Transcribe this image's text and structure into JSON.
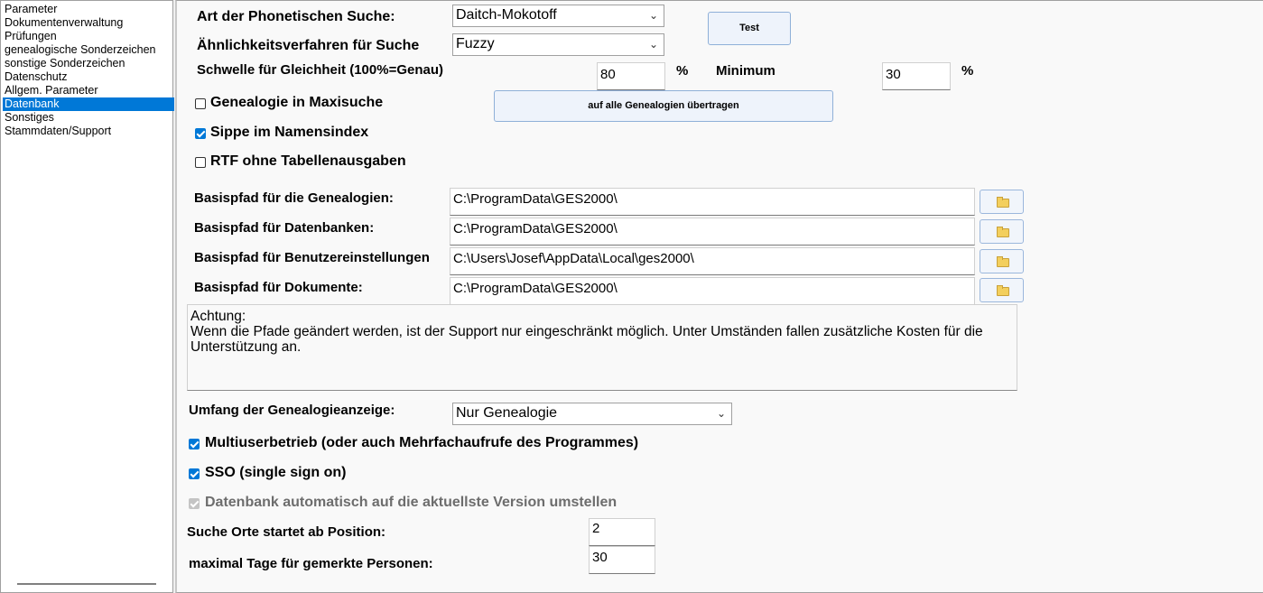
{
  "sidebar": {
    "items": [
      {
        "label": "Parameter",
        "active": false
      },
      {
        "label": "Dokumentenverwaltung",
        "active": false
      },
      {
        "label": "Prüfungen",
        "active": false
      },
      {
        "label": "genealogische Sonderzeichen",
        "active": false
      },
      {
        "label": "sonstige Sonderzeichen",
        "active": false
      },
      {
        "label": "Datenschutz",
        "active": false
      },
      {
        "label": "Allgem. Parameter",
        "active": false
      },
      {
        "label": "Datenbank",
        "active": true
      },
      {
        "label": "Sonstiges",
        "active": false
      },
      {
        "label": "Stammdaten/Support",
        "active": false
      }
    ]
  },
  "phonetic": {
    "label": "Art der Phonetischen Suche:",
    "value": "Daitch-Mokotoff"
  },
  "similarity": {
    "label": "Ähnlichkeitsverfahren für Suche",
    "value": "Fuzzy"
  },
  "test_button": "Test",
  "threshold": {
    "label": "Schwelle für Gleichheit (100%=Genau)",
    "value": "80",
    "unit": "%",
    "min_label": "Minimum",
    "min_value": "30",
    "min_unit": "%"
  },
  "apply_all_button": "auf alle Genealogien übertragen",
  "options_top": [
    {
      "label": "Genealogie in Maxisuche",
      "checked": false
    },
    {
      "label": "Sippe im Namensindex",
      "checked": true
    },
    {
      "label": "RTF ohne Tabellenausgaben",
      "checked": false
    }
  ],
  "paths": [
    {
      "label": "Basispfad für die Genealogien:",
      "value": "C:\\ProgramData\\GES2000\\"
    },
    {
      "label": "Basispfad für Datenbanken:",
      "value": "C:\\ProgramData\\GES2000\\"
    },
    {
      "label": "Basispfad für Benutzereinstellungen",
      "value": "C:\\Users\\Josef\\AppData\\Local\\ges2000\\"
    },
    {
      "label": "Basispfad für Dokumente:",
      "value": "C:\\ProgramData\\GES2000\\"
    }
  ],
  "notice": {
    "title": "Achtung:",
    "text": "Wenn die Pfade geändert werden, ist der Support nur eingeschränkt möglich. Unter Umständen fallen zusätzliche Kosten für die Unterstützung an."
  },
  "scope": {
    "label": "Umfang der Genealogieanzeige:",
    "value": "Nur Genealogie"
  },
  "options_bottom": [
    {
      "label": "Multiuserbetrieb (oder auch Mehrfachaufrufe des Programmes)",
      "checked": true,
      "disabled": false
    },
    {
      "label": "SSO (single sign on)",
      "checked": true,
      "disabled": false
    },
    {
      "label": "Datenbank automatisch auf die aktuellste Version umstellen",
      "checked": true,
      "disabled": true
    }
  ],
  "search_places": {
    "label": "Suche Orte startet ab Position:",
    "value": "2"
  },
  "max_days": {
    "label": "maximal Tage für gemerkte Personen:",
    "value": "30"
  },
  "icons": {
    "dropdown": "chevron-down-icon",
    "folder": "folder-icon",
    "checkbox": "checkmark-icon"
  },
  "colors": {
    "selection": "#0078d7",
    "button_bg": "#eef3fb",
    "button_border": "#8fb0d8"
  }
}
